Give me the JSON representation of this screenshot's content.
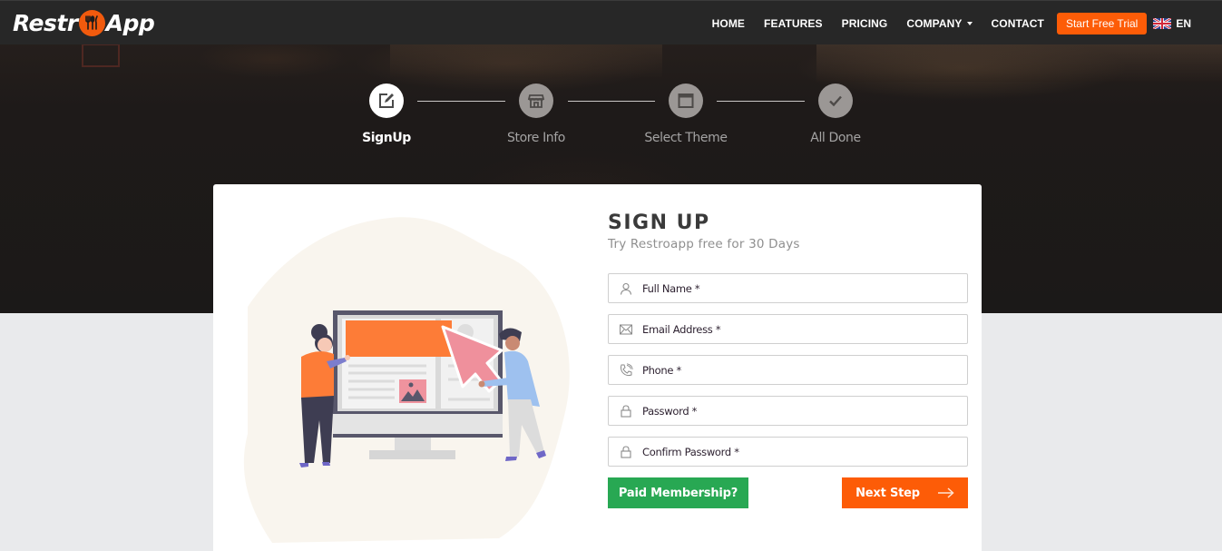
{
  "brand": {
    "name_left": "Restr",
    "name_right": "App",
    "logo_icon": "cutlery-icon",
    "accent_color": "#fd5c07",
    "success_color": "#28a853"
  },
  "nav": {
    "links": [
      {
        "label": "HOME"
      },
      {
        "label": "FEATURES"
      },
      {
        "label": "PRICING"
      },
      {
        "label": "COMPANY",
        "has_dropdown": true
      },
      {
        "label": "CONTACT"
      }
    ],
    "cta_label": "Start Free Trial",
    "language": {
      "code": "EN",
      "icon": "uk-flag-icon"
    }
  },
  "stepper": {
    "current_step": 1,
    "steps": [
      {
        "label": "SignUp",
        "icon": "edit-icon",
        "active": true
      },
      {
        "label": "Store Info",
        "icon": "store-icon",
        "active": false
      },
      {
        "label": "Select Theme",
        "icon": "browser-window-icon",
        "active": false
      },
      {
        "label": "All Done",
        "icon": "checkmark-icon",
        "active": false
      }
    ]
  },
  "form": {
    "title": "SIGN UP",
    "subtitle": "Try Restroapp free for 30 Days",
    "fields": [
      {
        "name": "full-name",
        "placeholder": "Full Name *",
        "value": "",
        "icon": "user-icon",
        "type": "text"
      },
      {
        "name": "email",
        "placeholder": "Email Address *",
        "value": "",
        "icon": "envelope-icon",
        "type": "email"
      },
      {
        "name": "phone",
        "placeholder": "Phone *",
        "value": "",
        "icon": "phone-icon",
        "type": "tel"
      },
      {
        "name": "password",
        "placeholder": "Password *",
        "value": "",
        "icon": "lock-icon",
        "type": "password"
      },
      {
        "name": "confirm-password",
        "placeholder": "Confirm Password *",
        "value": "",
        "icon": "lock-icon",
        "type": "password"
      }
    ],
    "paid_membership_label": "Paid Membership?",
    "next_step_label": "Next Step"
  },
  "illustration": {
    "description": "Two people interacting with a large monitor showing a website layout and a pointer cursor"
  }
}
